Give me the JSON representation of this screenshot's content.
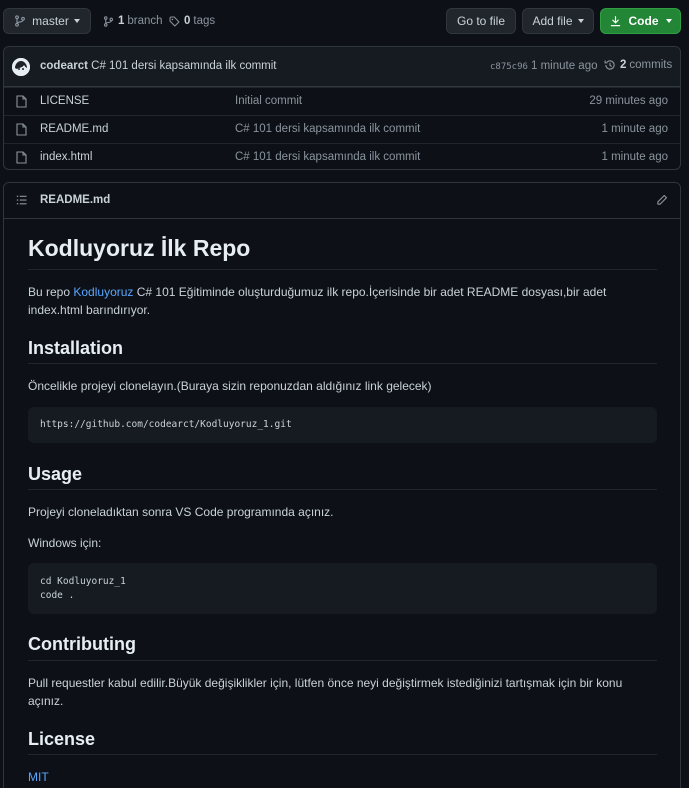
{
  "toolbar": {
    "branch_label": "master",
    "branch_count": "1",
    "branch_word": "branch",
    "tag_count": "0",
    "tag_word": "tags",
    "goto_file": "Go to file",
    "add_file": "Add file",
    "code": "Code"
  },
  "commit": {
    "author": "codearct",
    "message": "C# 101 dersi kapsamında ilk commit",
    "sha": "c875c96",
    "time": "1 minute ago",
    "count": "2",
    "count_word": "commits"
  },
  "files": [
    {
      "name": "LICENSE",
      "message": "Initial commit",
      "time": "29 minutes ago"
    },
    {
      "name": "README.md",
      "message": "C# 101 dersi kapsamında ilk commit",
      "time": "1 minute ago"
    },
    {
      "name": "index.html",
      "message": "C# 101 dersi kapsamında ilk commit",
      "time": "1 minute ago"
    }
  ],
  "readme": {
    "file_title": "README.md",
    "h1": "Kodluyoruz İlk Repo",
    "intro_pre": "Bu repo ",
    "intro_link": "Kodluyoruz",
    "intro_post": " C# 101 Eğitiminde oluşturduğumuz ilk repo.İçerisinde bir adet README dosyası,bir adet index.html barındırıyor.",
    "installation_h": "Installation",
    "installation_p": "Öncelikle projeyi clonelayın.(Buraya sizin reponuzdan aldığınız link gelecek)",
    "installation_code": "https://github.com/codearct/Kodluyoruz_1.git",
    "usage_h": "Usage",
    "usage_p": "Projeyi cloneladıktan sonra VS Code programında açınız.",
    "windows_p": "Windows için:",
    "usage_code_1": "cd Kodluyoruz_1",
    "usage_code_2": "code .",
    "contributing_h": "Contributing",
    "contributing_p": "Pull requestler kabul edilir.Büyük değişiklikler için, lütfen önce neyi değiştirmek istediğinizi tartışmak için bir konu açınız.",
    "license_h": "License",
    "license_link": "MIT"
  },
  "colors": {
    "background": "#0d1117",
    "code_button": "#238636",
    "link": "#58a6ff"
  }
}
